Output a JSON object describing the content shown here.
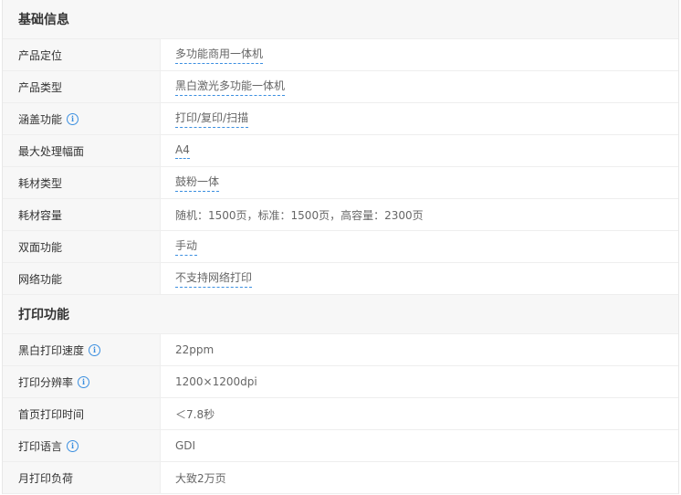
{
  "sections": [
    {
      "title": "基础信息",
      "rows": [
        {
          "label": "产品定位",
          "value": "多功能商用一体机",
          "info": false,
          "link": true
        },
        {
          "label": "产品类型",
          "value": "黑白激光多功能一体机",
          "info": false,
          "link": true
        },
        {
          "label": "涵盖功能",
          "value": "打印/复印/扫描",
          "info": true,
          "link": true
        },
        {
          "label": "最大处理幅面",
          "value": "A4",
          "info": false,
          "link": true
        },
        {
          "label": "耗材类型",
          "value": "鼓粉一体",
          "info": false,
          "link": true
        },
        {
          "label": "耗材容量",
          "value": "随机：1500页，标准：1500页，高容量：2300页",
          "info": false,
          "link": false
        },
        {
          "label": "双面功能",
          "value": "手动",
          "info": false,
          "link": true
        },
        {
          "label": "网络功能",
          "value": "不支持网络打印",
          "info": false,
          "link": true
        }
      ]
    },
    {
      "title": "打印功能",
      "rows": [
        {
          "label": "黑白打印速度",
          "value": "22ppm",
          "info": true,
          "link": false
        },
        {
          "label": "打印分辨率",
          "value": "1200×1200dpi",
          "info": true,
          "link": false
        },
        {
          "label": "首页打印时间",
          "value": "＜7.8秒",
          "info": false,
          "link": false
        },
        {
          "label": "打印语言",
          "value": "GDI",
          "info": true,
          "link": false
        },
        {
          "label": "月打印负荷",
          "value": "大致2万页",
          "info": false,
          "link": false
        }
      ]
    }
  ],
  "icons": {
    "info": "info-icon",
    "info_glyph": "i"
  },
  "colors": {
    "link_underline": "#3b8fe0",
    "header_bg": "#f7f7f7"
  }
}
